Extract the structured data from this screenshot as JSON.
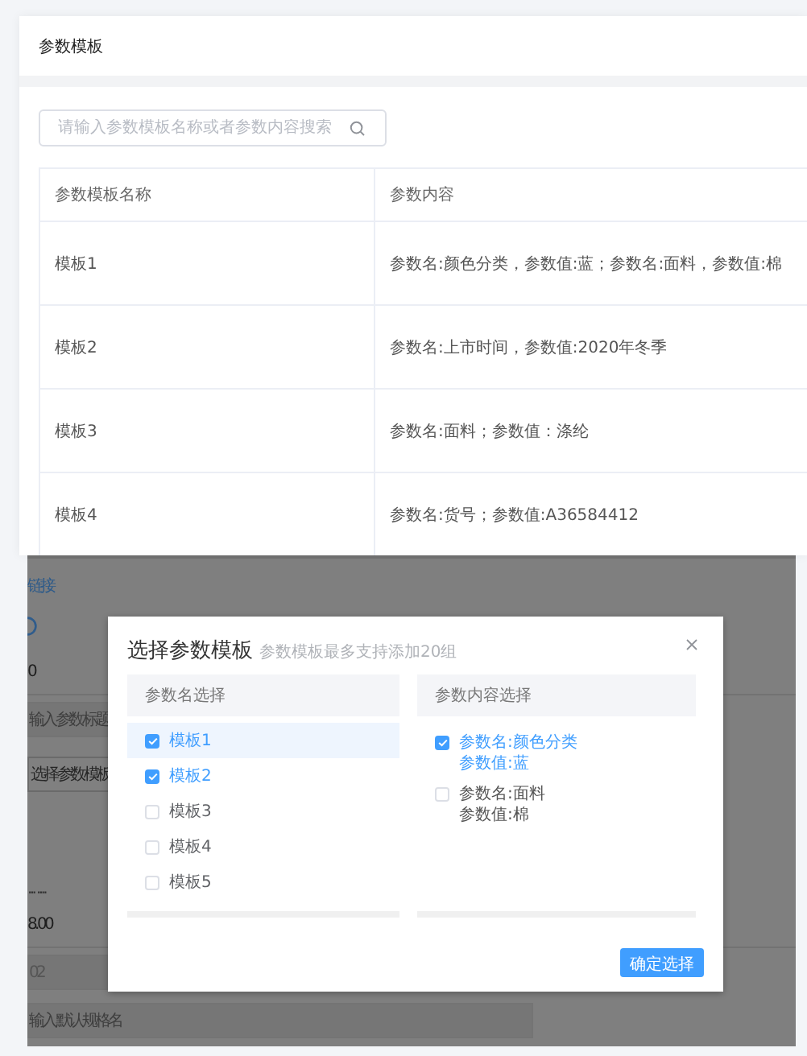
{
  "page_title": "参数模板",
  "search": {
    "placeholder": "请输入参数模板名称或者参数内容搜索"
  },
  "table": {
    "columns": [
      "参数模板名称",
      "参数内容"
    ],
    "rows": [
      {
        "name": "模板1",
        "content": "参数名:颜色分类，参数值:蓝；参数名:面料，参数值:棉"
      },
      {
        "name": "模板2",
        "content": "参数名:上市时间，参数值:2020年冬季"
      },
      {
        "name": "模板3",
        "content": "参数名:面料；参数值：涤纶"
      },
      {
        "name": "模板4",
        "content": "参数名:货号；参数值:A36584412"
      }
    ]
  },
  "background_form": [
    {
      "kind": "link",
      "text": "链接"
    },
    {
      "kind": "radio"
    },
    {
      "kind": "value",
      "text": "0"
    },
    {
      "kind": "field",
      "placeholder": "输入参数标题"
    },
    {
      "kind": "button",
      "text": "选择参数模板"
    },
    {
      "kind": "text",
      "text": "... ...."
    },
    {
      "kind": "value",
      "text": "8.00"
    },
    {
      "kind": "field",
      "text": "02"
    },
    {
      "kind": "field",
      "placeholder": "输入默认规格名"
    }
  ],
  "dialog": {
    "title": "选择参数模板",
    "hint": "参数模板最多支持添加20组",
    "left_panel": {
      "heading": "参数名选择",
      "items": [
        {
          "label": "模板1",
          "checked": true,
          "selected": true
        },
        {
          "label": "模板2",
          "checked": true,
          "selected": false
        },
        {
          "label": "模板3",
          "checked": false,
          "selected": false
        },
        {
          "label": "模板4",
          "checked": false,
          "selected": false
        },
        {
          "label": "模板5",
          "checked": false,
          "selected": false
        }
      ]
    },
    "right_panel": {
      "heading": "参数内容选择",
      "items": [
        {
          "lines": [
            "参数名:颜色分类",
            "参数值:蓝"
          ],
          "checked": true
        },
        {
          "lines": [
            "参数名:面料",
            "参数值:棉"
          ],
          "checked": false
        }
      ]
    },
    "confirm_button": "确定选择"
  }
}
